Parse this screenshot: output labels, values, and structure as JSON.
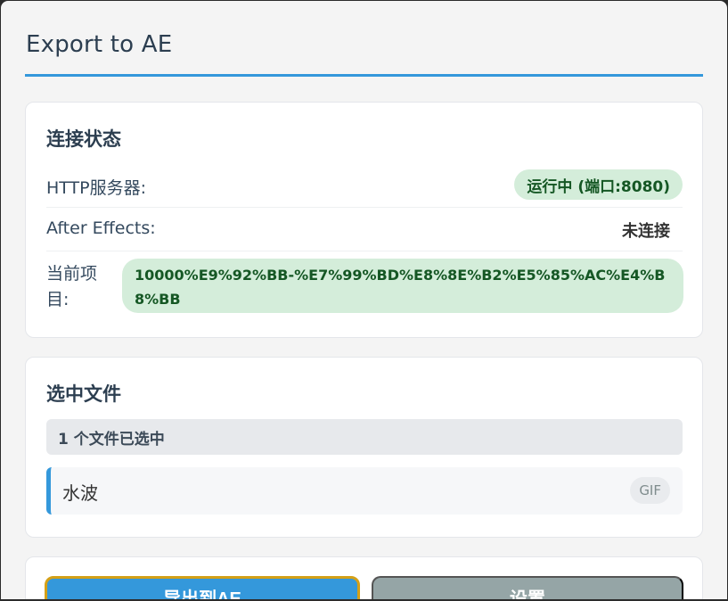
{
  "page": {
    "title": "Export to AE"
  },
  "connection": {
    "title": "连接状态",
    "http_label": "HTTP服务器:",
    "http_status": "运行中 (端口:8080)",
    "ae_label": "After Effects:",
    "ae_status": "未连接",
    "project_label": "当前项目:",
    "project_value": "10000%E9%92%BB-%E7%99%BD%E8%8E%B2%E5%85%AC%E4%B8%BB"
  },
  "selection": {
    "title": "选中文件",
    "count_text": "1 个文件已选中",
    "files": [
      {
        "name": "水波",
        "type": "GIF"
      }
    ]
  },
  "actions": {
    "export_label": "导出到AE",
    "settings_label": "设置"
  },
  "colors": {
    "accent": "#3498db",
    "success_bg": "#d4edda",
    "success_text": "#155724",
    "secondary": "#95a5a6"
  }
}
